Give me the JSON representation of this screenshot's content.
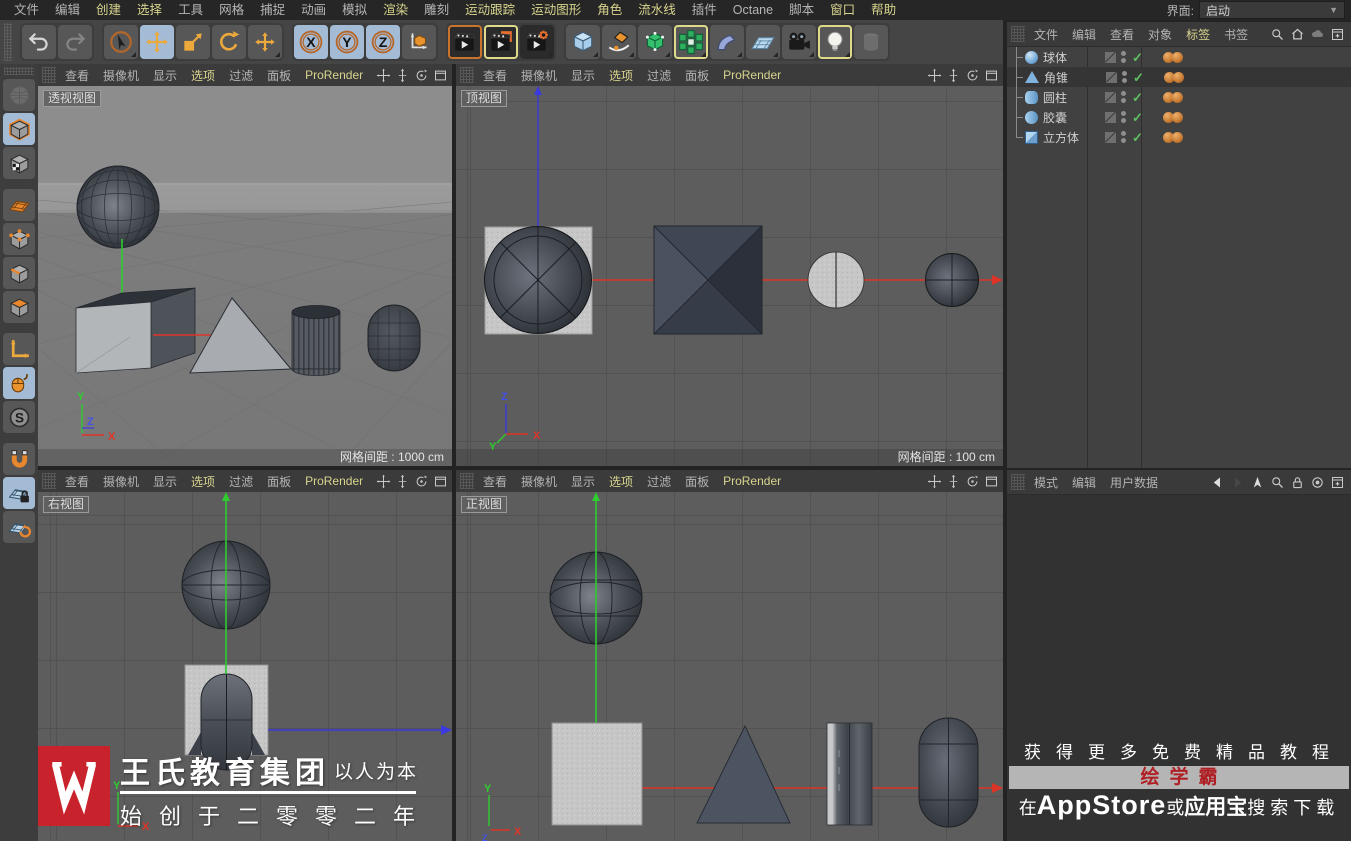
{
  "menu_bar": {
    "items": [
      {
        "label": "文件",
        "hl": false
      },
      {
        "label": "编辑",
        "hl": false
      },
      {
        "label": "创建",
        "hl": true
      },
      {
        "label": "选择",
        "hl": true
      },
      {
        "label": "工具",
        "hl": false
      },
      {
        "label": "网格",
        "hl": false
      },
      {
        "label": "捕捉",
        "hl": false
      },
      {
        "label": "动画",
        "hl": false
      },
      {
        "label": "模拟",
        "hl": false
      },
      {
        "label": "渲染",
        "hl": true
      },
      {
        "label": "雕刻",
        "hl": false
      },
      {
        "label": "运动跟踪",
        "hl": true
      },
      {
        "label": "运动图形",
        "hl": true
      },
      {
        "label": "角色",
        "hl": true
      },
      {
        "label": "流水线",
        "hl": true
      },
      {
        "label": "插件",
        "hl": false
      },
      {
        "label": "Octane",
        "hl": false
      },
      {
        "label": "脚本",
        "hl": false
      },
      {
        "label": "窗口",
        "hl": true
      },
      {
        "label": "帮助",
        "hl": true
      }
    ],
    "interface_label": "界面:",
    "interface_value": "启动"
  },
  "toolbar": {
    "groups": [
      {
        "items": [
          {
            "name": "undo"
          },
          {
            "name": "redo",
            "disabled": true
          }
        ]
      },
      {
        "items": [
          {
            "name": "live-selection",
            "corner": true
          },
          {
            "name": "move-tool",
            "active": true
          },
          {
            "name": "scale-tool"
          },
          {
            "name": "rotate-tool"
          },
          {
            "name": "last-tool",
            "corner": true
          }
        ]
      },
      {
        "items": [
          {
            "name": "x-axis-lock",
            "active": true
          },
          {
            "name": "y-axis-lock",
            "active": true
          },
          {
            "name": "z-axis-lock",
            "active": true
          },
          {
            "name": "coordinate-system"
          }
        ]
      },
      {
        "items": [
          {
            "name": "render-view",
            "dark": true,
            "framed": "orange"
          },
          {
            "name": "render-picture-viewer",
            "dark": true,
            "framed": "yellow"
          },
          {
            "name": "render-settings",
            "dark": true,
            "corner": true
          }
        ]
      },
      {
        "items": [
          {
            "name": "primitive-cube",
            "corner": true
          },
          {
            "name": "spline-pen",
            "corner": true
          },
          {
            "name": "subdivision-surface",
            "corner": true
          },
          {
            "name": "mograph-array",
            "framed": "yellow",
            "corner": true
          },
          {
            "name": "deformer",
            "corner": true
          },
          {
            "name": "environment",
            "corner": true
          },
          {
            "name": "camera",
            "corner": true
          },
          {
            "name": "light",
            "framed": "yellow",
            "corner": true
          },
          {
            "name": "volume",
            "disabled": true
          }
        ]
      }
    ]
  },
  "left_toolbar": {
    "icons": [
      {
        "name": "make-editable",
        "disabled": true
      },
      {
        "name": "model-mode",
        "active": true,
        "corner": true
      },
      {
        "name": "texture-mode"
      },
      {
        "name": "texture-axis-mode",
        "gap": true
      },
      {
        "name": "points-mode"
      },
      {
        "name": "edge-mode"
      },
      {
        "name": "polygon-mode"
      },
      {
        "name": "axis-mode",
        "gap": true
      },
      {
        "name": "viewport-solo",
        "active": true
      },
      {
        "name": "snap-settings",
        "corner": true
      },
      {
        "name": "enable-snap",
        "gap": true
      },
      {
        "name": "lock-workplane",
        "active": true
      },
      {
        "name": "workplane-mode"
      }
    ]
  },
  "viewport_menu": [
    {
      "label": "查看",
      "hl": false
    },
    {
      "label": "摄像机",
      "hl": false
    },
    {
      "label": "显示",
      "hl": false
    },
    {
      "label": "选项",
      "hl": true
    },
    {
      "label": "过滤",
      "hl": false
    },
    {
      "label": "面板",
      "hl": false
    },
    {
      "label": "ProRender",
      "hl": true
    }
  ],
  "viewport_header_icons": [
    {
      "name": "camera-pan"
    },
    {
      "name": "camera-zoom"
    },
    {
      "name": "camera-rotate"
    },
    {
      "name": "toggle-view"
    }
  ],
  "viewports": [
    {
      "label": "透视视图",
      "grid_label": "网格间距 : 1000 cm",
      "objects": [
        "球体",
        "立方体",
        "角锥",
        "圆柱",
        "胶囊"
      ]
    },
    {
      "label": "顶视图",
      "grid_label": "网格间距 : 100 cm",
      "objects": [
        "球体",
        "立方体",
        "角锥",
        "圆柱",
        "胶囊"
      ]
    },
    {
      "label": "右视图",
      "grid_label": "",
      "objects": [
        "球体",
        "立方体",
        "胶囊"
      ]
    },
    {
      "label": "正视图",
      "grid_label": "",
      "objects": [
        "球体",
        "立方体",
        "角锥",
        "圆柱",
        "胶囊"
      ]
    }
  ],
  "axis_labels": [
    "X",
    "Y",
    "Z"
  ],
  "object_manager": {
    "menu": [
      {
        "label": "文件",
        "hl": false
      },
      {
        "label": "编辑",
        "hl": false
      },
      {
        "label": "查看",
        "hl": false
      },
      {
        "label": "对象",
        "hl": false
      },
      {
        "label": "标签",
        "hl": true
      },
      {
        "label": "书签",
        "hl": false
      }
    ],
    "icons": [
      {
        "name": "search"
      },
      {
        "name": "home"
      },
      {
        "name": "cloud"
      },
      {
        "name": "add-panel"
      }
    ],
    "objects": [
      {
        "name": "球体",
        "type": "sphere",
        "selected": false
      },
      {
        "name": "角锥",
        "type": "pyramid",
        "selected": true
      },
      {
        "name": "圆柱",
        "type": "cylinder",
        "selected": false
      },
      {
        "name": "胶囊",
        "type": "capsule",
        "selected": false
      },
      {
        "name": "立方体",
        "type": "cube",
        "selected": false
      }
    ]
  },
  "attribute_manager": {
    "menu": [
      {
        "label": "模式",
        "hl": false
      },
      {
        "label": "编辑",
        "hl": false
      },
      {
        "label": "用户数据",
        "hl": false
      }
    ],
    "icons": [
      {
        "name": "history-back"
      },
      {
        "name": "history-forward",
        "disabled": true
      },
      {
        "name": "pick"
      },
      {
        "name": "search"
      },
      {
        "name": "lock"
      },
      {
        "name": "target"
      },
      {
        "name": "add-panel"
      }
    ]
  },
  "watermark": {
    "brand": "王氏教育集团",
    "slogan": "以人为本",
    "founded": "始创于二零零二年"
  },
  "promo": {
    "line1": "获得更多免费精品教程",
    "badge": "绘学霸",
    "l3_prefix": "在",
    "l3_appstore": "AppStore",
    "l3_or": "或",
    "l3_store": "应用宝",
    "l3_suffix": "搜索下载"
  },
  "colors": {
    "menu_accent": "#d8d48e",
    "tool_orange": "#e8932e",
    "active_blue": "#a4bbd6",
    "axis_x": "#e03427",
    "axis_y": "#2ecc2e",
    "axis_z": "#3a3ae0",
    "logo_red": "#c8232c",
    "badge_red": "#b01f24",
    "check_green": "#5fc161"
  }
}
